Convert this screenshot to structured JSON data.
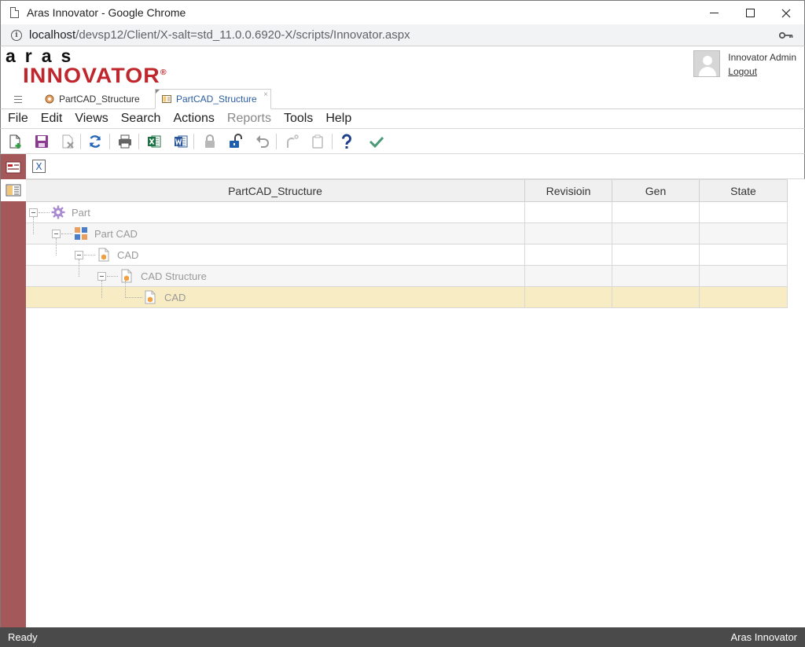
{
  "window": {
    "title": "Aras Innovator - Google Chrome",
    "url_host": "localhost",
    "url_path": "/devsp12/Client/X-salt=std_11.0.0.6920-X/scripts/Innovator.aspx"
  },
  "header": {
    "logo_top": "aras",
    "logo_bottom": "INNOVATOR",
    "logo_reg": "®",
    "user_name": "Innovator Admin",
    "logout": "Logout"
  },
  "tabs": [
    {
      "label": "PartCAD_Structure",
      "icon": "item-type-icon"
    },
    {
      "label": "PartCAD_Structure",
      "icon": "structure-view-icon",
      "close": "×"
    }
  ],
  "menu": [
    "File",
    "Edit",
    "Views",
    "Search",
    "Actions",
    "Reports",
    "Tools",
    "Help"
  ],
  "menu_disabled": [
    "Reports"
  ],
  "toolbar": [
    "new-icon",
    "save-icon",
    "discard-icon",
    "refresh-icon",
    "print-icon",
    "excel-icon",
    "word-icon",
    "lock-icon",
    "unlock-icon",
    "undo-icon",
    "redo-icon",
    "delete-icon",
    "help-icon",
    "done-icon"
  ],
  "subtool": {
    "excel_label": "X"
  },
  "grid": {
    "headers": [
      "PartCAD_Structure",
      "Revisioin",
      "Gen",
      "State"
    ],
    "rows": [
      {
        "label": "Part",
        "level": 0,
        "icon": "gear-icon"
      },
      {
        "label": "Part CAD",
        "level": 1,
        "icon": "relationship-icon"
      },
      {
        "label": "CAD",
        "level": 2,
        "icon": "cad-document-icon"
      },
      {
        "label": "CAD Structure",
        "level": 3,
        "icon": "cad-document-icon"
      },
      {
        "label": "CAD",
        "level": 4,
        "icon": "cad-document-icon"
      }
    ]
  },
  "status": {
    "left": "Ready",
    "right": "Aras Innovator"
  },
  "colors": {
    "brand_red": "#c0272d",
    "rail": "#a5585a",
    "selected_row": "#f8ecc4",
    "status_bar": "#4a4a4a"
  }
}
